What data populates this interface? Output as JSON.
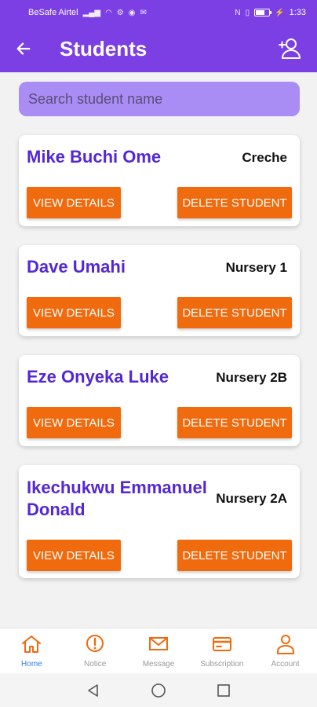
{
  "status_bar": {
    "carrier": "BeSafe Airtel",
    "time": "1:33"
  },
  "app_bar": {
    "title": "Students"
  },
  "search": {
    "placeholder": "Search student name"
  },
  "students": [
    {
      "name": "Mike  Buchi Ome",
      "class": "Creche"
    },
    {
      "name": "Dave  Umahi",
      "class": "Nursery 1"
    },
    {
      "name": "Eze  Onyeka Luke",
      "class": "Nursery 2B"
    },
    {
      "name": "Ikechukwu  Emmanuel Donald",
      "class": "Nursery 2A"
    }
  ],
  "actions": {
    "view_label": "VIEW DETAILS",
    "delete_label": "DELETE STUDENT"
  },
  "bottom_nav": [
    {
      "label": "Home",
      "icon": "home-icon",
      "active": true
    },
    {
      "label": "Notice",
      "icon": "alert-circle-icon",
      "active": false
    },
    {
      "label": "Message",
      "icon": "mail-icon",
      "active": false
    },
    {
      "label": "Subscription",
      "icon": "card-icon",
      "active": false
    },
    {
      "label": "Account",
      "icon": "person-icon",
      "active": false
    }
  ],
  "colors": {
    "primary": "#7b3fe4",
    "accent": "#f06a0e",
    "name_text": "#5327d6",
    "active_nav": "#2f7ee6"
  }
}
